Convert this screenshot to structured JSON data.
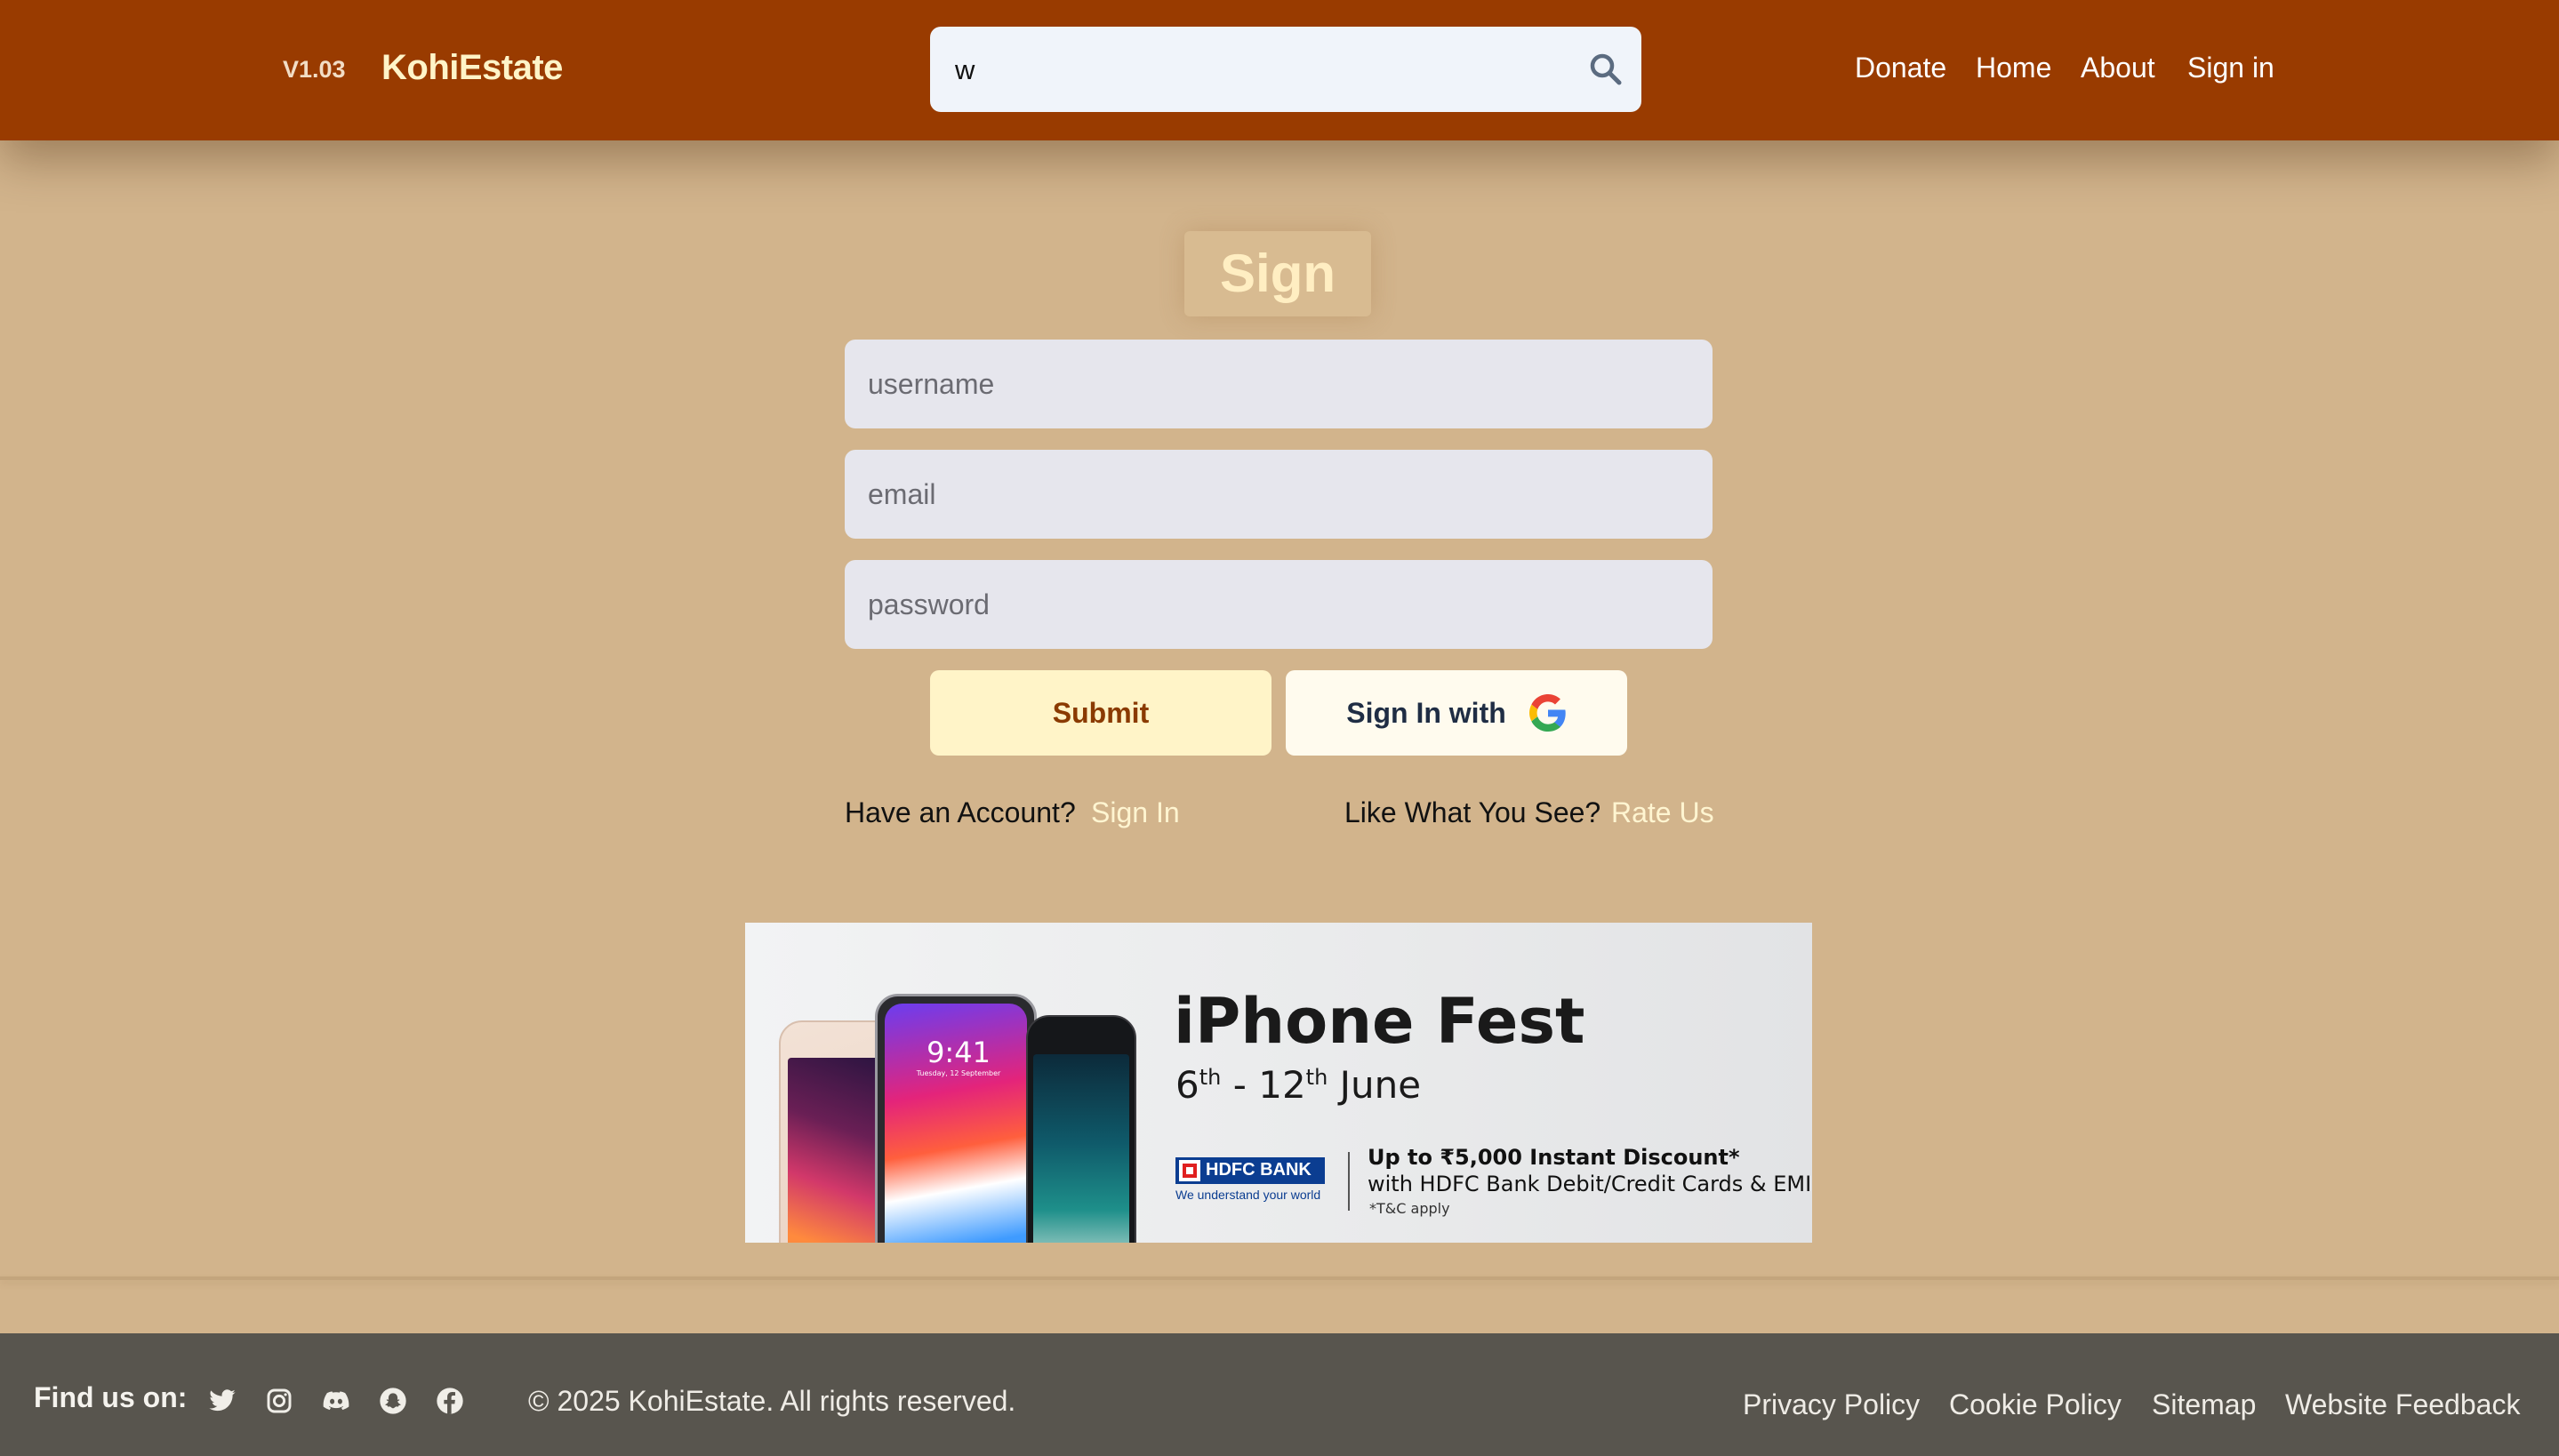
{
  "header": {
    "version": "V1.03",
    "brand": "KohiEstate",
    "search_value": "w",
    "nav": [
      "Donate",
      "Home",
      "About",
      "Sign in"
    ]
  },
  "signup": {
    "title": "Sign Up",
    "username_placeholder": "username",
    "email_placeholder": "email",
    "password_placeholder": "password",
    "submit_label": "Submit",
    "google_label": "Sign In with",
    "have_account": "Have an Account?",
    "sign_in_link": "Sign In",
    "like_what": "Like What You See?",
    "rate_link": "Rate Us"
  },
  "ad": {
    "title": "iPhone Fest",
    "dates_start": "6",
    "dates_start_suffix": "th",
    "dates_sep": " - ",
    "dates_end": "12",
    "dates_end_suffix": "th",
    "dates_month": " June",
    "bank_name": "HDFC BANK",
    "bank_tagline": "We understand your world",
    "offer_line1": "Up to ₹5,000 Instant Discount*",
    "offer_line2": "with HDFC Bank Debit/Credit Cards & EMI",
    "terms": "*T&C apply",
    "phone_time": "9:41",
    "phone_date": "Tuesday, 12 September"
  },
  "footer": {
    "find_us": "Find us on:",
    "social_icons": [
      "twitter-icon",
      "instagram-icon",
      "discord-icon",
      "snapchat-icon",
      "facebook-icon"
    ],
    "copyright": "© 2025 KohiEstate. All rights reserved.",
    "links": [
      "Privacy Policy",
      "Cookie Policy",
      "Sitemap",
      "Website Feedback"
    ]
  },
  "colors": {
    "header_bg": "#993b00",
    "page_bg": "#d2b48c",
    "footer_bg": "#58554e",
    "accent_cream": "#fff4c8"
  }
}
